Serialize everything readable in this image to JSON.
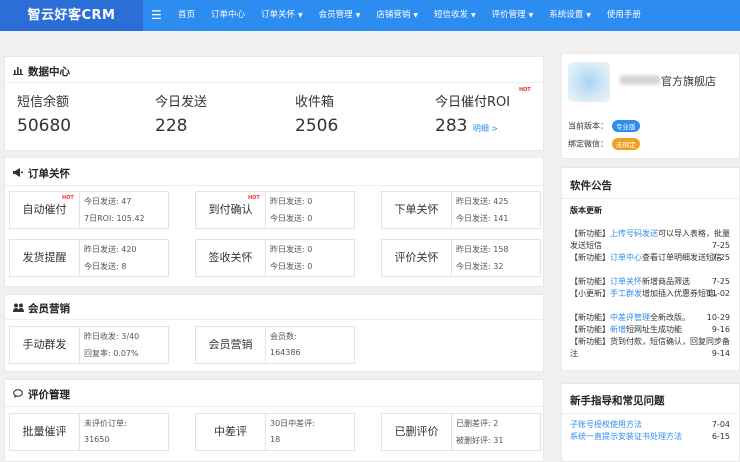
{
  "topbar": {
    "logo": "智云好客CRM",
    "menu_icon": "hamburger-icon",
    "nav": [
      "首页",
      "订单中心",
      "订单关怀",
      "会员管理",
      "店铺营销",
      "短信收发",
      "评价管理",
      "系统设置",
      "使用手册"
    ],
    "nav_dropdown": [
      false,
      false,
      true,
      true,
      true,
      true,
      true,
      true,
      false
    ],
    "caret": "▼"
  },
  "data_center": {
    "title": "数据中心",
    "icon": "bar-chart-icon",
    "stats": [
      {
        "label": "短信余额",
        "value": "50680"
      },
      {
        "label": "今日发送",
        "value": "228"
      },
      {
        "label": "收件箱",
        "value": "2506"
      },
      {
        "label": "今日催付ROI",
        "value": "283",
        "link": "明细 >",
        "hot": "HOT"
      }
    ]
  },
  "order_care": {
    "title": "订单关怀",
    "icon": "megaphone-icon",
    "items": [
      {
        "name": "自动催付",
        "hot": "HOT",
        "l1": "今日发送: 47",
        "l2": "7日ROI: 105.42"
      },
      {
        "name": "到付确认",
        "hot": "HOT",
        "l1": "昨日发送: 0",
        "l2": "今日发送: 0"
      },
      {
        "name": "下单关怀",
        "l1": "昨日发送: 425",
        "l2": "今日发送: 141"
      },
      {
        "name": "发货提醒",
        "l1": "昨日发送: 420",
        "l2": "今日发送: 8"
      },
      {
        "name": "签收关怀",
        "l1": "昨日发送: 0",
        "l2": "今日发送: 0"
      },
      {
        "name": "评价关怀",
        "l1": "昨日发送: 158",
        "l2": "今日发送: 32"
      }
    ]
  },
  "member_marketing": {
    "title": "会员营销",
    "icon": "users-icon",
    "items": [
      {
        "name": "手动群发",
        "l1": "昨日收发: 3/40",
        "l2": "回复率: 0.07%"
      },
      {
        "name": "会员营销",
        "l1": "会员数:",
        "l2": "164386"
      }
    ]
  },
  "review_mgmt": {
    "title": "评价管理",
    "icon": "chat-bubble-icon",
    "items": [
      {
        "name": "批量催评",
        "l1": "未评价订单:",
        "l2": "31650"
      },
      {
        "name": "中差评",
        "l1": "30日中差评:",
        "l2": "18"
      },
      {
        "name": "已删评价",
        "l1": "已删差评: 2",
        "l2": "被删好评: 31"
      }
    ]
  },
  "shop": {
    "name": "官方旗舰店",
    "version_label": "当前版本：",
    "version_badge": "专业版",
    "version_color": "#2d8cf0",
    "wechat_label": "绑定微信：",
    "wechat_badge": "未绑定",
    "wechat_color": "#f0a020"
  },
  "announcements": {
    "title": "软件公告",
    "subtitle": "版本更新",
    "items": [
      {
        "tag": "【新功能】",
        "link": "上传号码发送",
        "text": "可以导入表格，批量发送短信",
        "date": "7-25"
      },
      {
        "tag": "【新功能】",
        "link": "订单中心",
        "text": "查看订单明细发送短信",
        "date": "7-25"
      },
      {
        "tag": "【新功能】",
        "link": "订单关怀",
        "text": "新增商品筛选",
        "date": "7-25"
      },
      {
        "tag": "【小更新】",
        "link": "手工群发",
        "text": "增加插入优惠券短链。",
        "date": "11-02"
      },
      {
        "tag": "【新功能】",
        "link": "中差评管理",
        "text": "全新改版。",
        "date": "10-29"
      },
      {
        "tag": "【新功能】",
        "link": "新增",
        "text": "短网址生成功能",
        "date": "9-16"
      },
      {
        "tag": "【新功能】",
        "link": "",
        "text": "货到付款，短信确认，回复同步备注",
        "date": "9-14"
      }
    ]
  },
  "guide": {
    "title": "新手指导和常见问题",
    "items": [
      {
        "text": "子账号授权使用方法",
        "date": "7-04"
      },
      {
        "text": "系统一直提示安装证书处理方法",
        "date": "6-15"
      }
    ]
  }
}
